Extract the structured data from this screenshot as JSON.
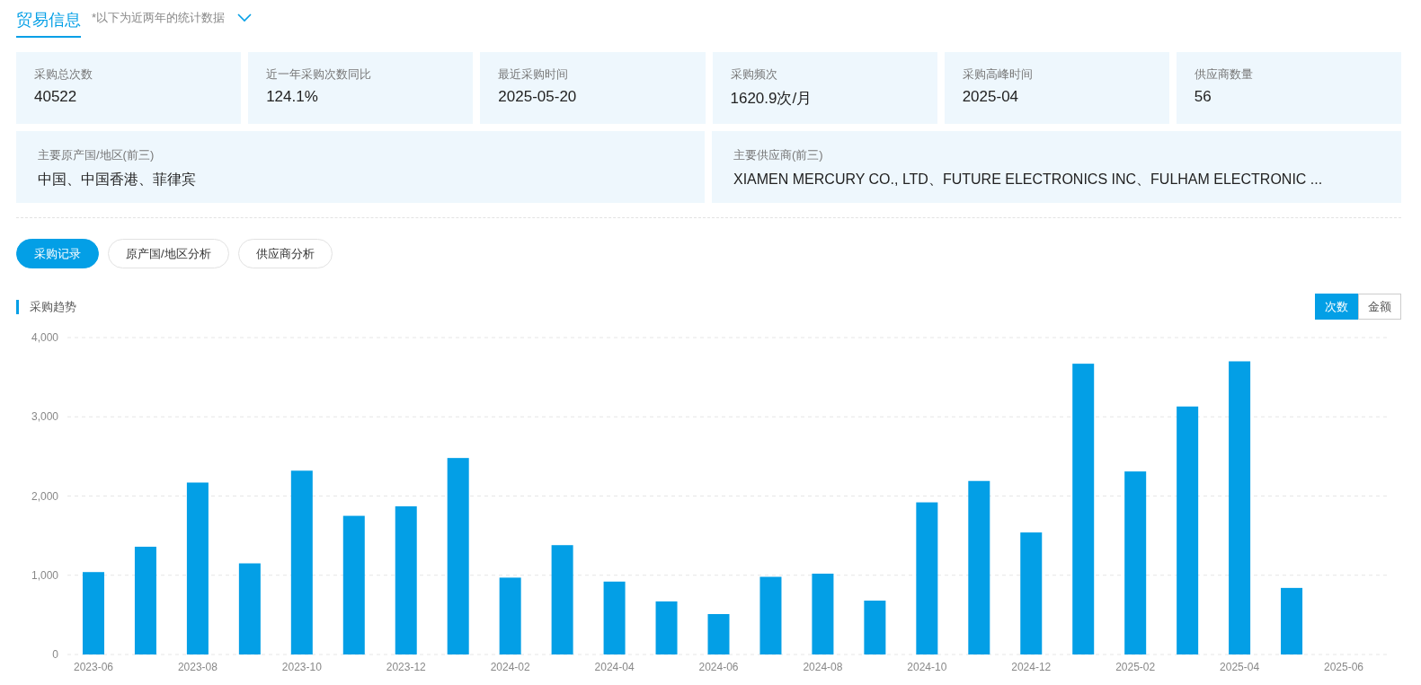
{
  "header": {
    "title": "贸易信息",
    "note": "*以下为近两年的统计数据"
  },
  "stats": [
    {
      "label": "采购总次数",
      "value": "40522"
    },
    {
      "label": "近一年采购次数同比",
      "value": "124.1%"
    },
    {
      "label": "最近采购时间",
      "value": "2025-05-20"
    },
    {
      "label": "采购频次",
      "value": "1620.9次/月"
    },
    {
      "label": "采购高峰时间",
      "value": "2025-04"
    },
    {
      "label": "供应商数量",
      "value": "56"
    }
  ],
  "summary": [
    {
      "label": "主要原产国/地区(前三)",
      "value": "中国、中国香港、菲律宾"
    },
    {
      "label": "主要供应商(前三)",
      "value": "XIAMEN MERCURY CO., LTD、FUTURE ELECTRONICS INC、FULHAM ELECTRONIC ..."
    }
  ],
  "tabs": [
    {
      "label": "采购记录",
      "selected": true
    },
    {
      "label": "原产国/地区分析",
      "selected": false
    },
    {
      "label": "供应商分析",
      "selected": false
    }
  ],
  "trend": {
    "title": "采购趋势",
    "toggles": [
      {
        "label": "次数",
        "selected": true
      },
      {
        "label": "金额",
        "selected": false
      }
    ],
    "chart_data": {
      "type": "bar",
      "grid": true,
      "categories": [
        "2023-06",
        null,
        "2023-08",
        null,
        "2023-10",
        null,
        "2023-12",
        null,
        "2024-02",
        null,
        "2024-04",
        null,
        "2024-06",
        null,
        "2024-08",
        null,
        "2024-10",
        null,
        "2024-12",
        null,
        "2025-02",
        null,
        "2025-04",
        null,
        "2025-06"
      ],
      "series": [
        {
          "color": "#039fe6",
          "values": [
            1040,
            1360,
            2170,
            1150,
            2320,
            1750,
            1870,
            2480,
            970,
            1380,
            920,
            670,
            510,
            980,
            1020,
            680,
            1920,
            2190,
            1540,
            3670,
            2310,
            3130,
            3700,
            840,
            null
          ]
        }
      ],
      "ylim": [
        0,
        4000
      ],
      "yticks": [
        {
          "value": 0,
          "label": "0"
        },
        {
          "value": 1000,
          "label": "1,000"
        },
        {
          "value": 2000,
          "label": "2,000"
        },
        {
          "value": 3000,
          "label": "3,000"
        },
        {
          "value": 4000,
          "label": "4,000"
        }
      ]
    }
  }
}
